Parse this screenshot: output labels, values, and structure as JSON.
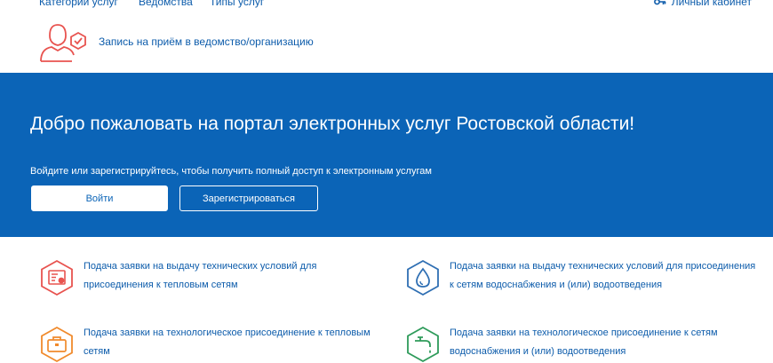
{
  "nav": {
    "categories": "Категории услуг",
    "departments": "Ведомства",
    "service_types": "Типы услуг",
    "account": "Личный кабинет"
  },
  "appointment": {
    "label": "Запись на приём в ведомство/организацию",
    "icon": "person-check-icon"
  },
  "hero": {
    "title": "Добро пожаловать на портал электронных услуг Ростовской области!",
    "subtitle": "Войдите или зарегистрируйтесь, чтобы получить полный доступ к электронным услугам",
    "login_label": "Войти",
    "register_label": "Зарегистрироваться",
    "background_color": "#0b64b7"
  },
  "services": [
    {
      "icon": "document-certificate-icon",
      "color": "#e8534f",
      "text": "Подача заявки на выдачу технических условий для присоединения к тепловым сетям"
    },
    {
      "icon": "water-drop-icon",
      "color": "#2f6fb3",
      "text": "Подача заявки на выдачу технических условий для присоединения к сетям водоснабжения и (или) водоотведения"
    },
    {
      "icon": "briefcase-icon",
      "color": "#f08a2c",
      "text": "Подача заявки на технологическое присоединение к тепловым сетям"
    },
    {
      "icon": "water-tap-icon",
      "color": "#2e9b5a",
      "text": "Подача заявки на технологическое присоединение к сетям водоснабжения и (или) водоотведения"
    }
  ]
}
